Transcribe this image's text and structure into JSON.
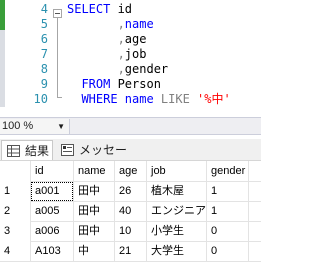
{
  "editor": {
    "line_numbers": [
      "4",
      "5",
      "6",
      "7",
      "8",
      "9",
      "10"
    ],
    "lines": [
      [
        {
          "t": "SELECT ",
          "c": "kw"
        },
        {
          "t": "id",
          "c": ""
        }
      ],
      [
        {
          "t": "       ,",
          "c": "gray"
        },
        {
          "t": "name",
          "c": "kw"
        }
      ],
      [
        {
          "t": "       ,",
          "c": "gray"
        },
        {
          "t": "age",
          "c": ""
        }
      ],
      [
        {
          "t": "       ,",
          "c": "gray"
        },
        {
          "t": "job",
          "c": ""
        }
      ],
      [
        {
          "t": "       ,",
          "c": "gray"
        },
        {
          "t": "gender",
          "c": ""
        }
      ],
      [
        {
          "t": "  FROM ",
          "c": "kw"
        },
        {
          "t": "Person",
          "c": ""
        }
      ],
      [
        {
          "t": "  WHERE ",
          "c": "kw"
        },
        {
          "t": "name ",
          "c": "kw"
        },
        {
          "t": "LIKE ",
          "c": "gray"
        },
        {
          "t": "'%中'",
          "c": "str"
        }
      ]
    ]
  },
  "zoom": {
    "value": "100 %"
  },
  "tabs": {
    "results": "結果",
    "messages": "メッセージ"
  },
  "grid": {
    "columns": [
      "id",
      "name",
      "age",
      "job",
      "gender"
    ],
    "rows": [
      {
        "num": "1",
        "cells": [
          "a001",
          "田中",
          "26",
          "植木屋",
          "1"
        ]
      },
      {
        "num": "2",
        "cells": [
          "a005",
          "田中",
          "40",
          "エンジニア",
          "1"
        ]
      },
      {
        "num": "3",
        "cells": [
          "a006",
          "田中",
          "10",
          "小学生",
          "0"
        ]
      },
      {
        "num": "4",
        "cells": [
          "A103",
          "中",
          "21",
          "大学生",
          "0"
        ]
      }
    ]
  },
  "colors": {
    "keyword": "#0000ff",
    "string": "#ff0000",
    "line_number": "#2b91af",
    "change_marker": "#3a9e3a"
  }
}
